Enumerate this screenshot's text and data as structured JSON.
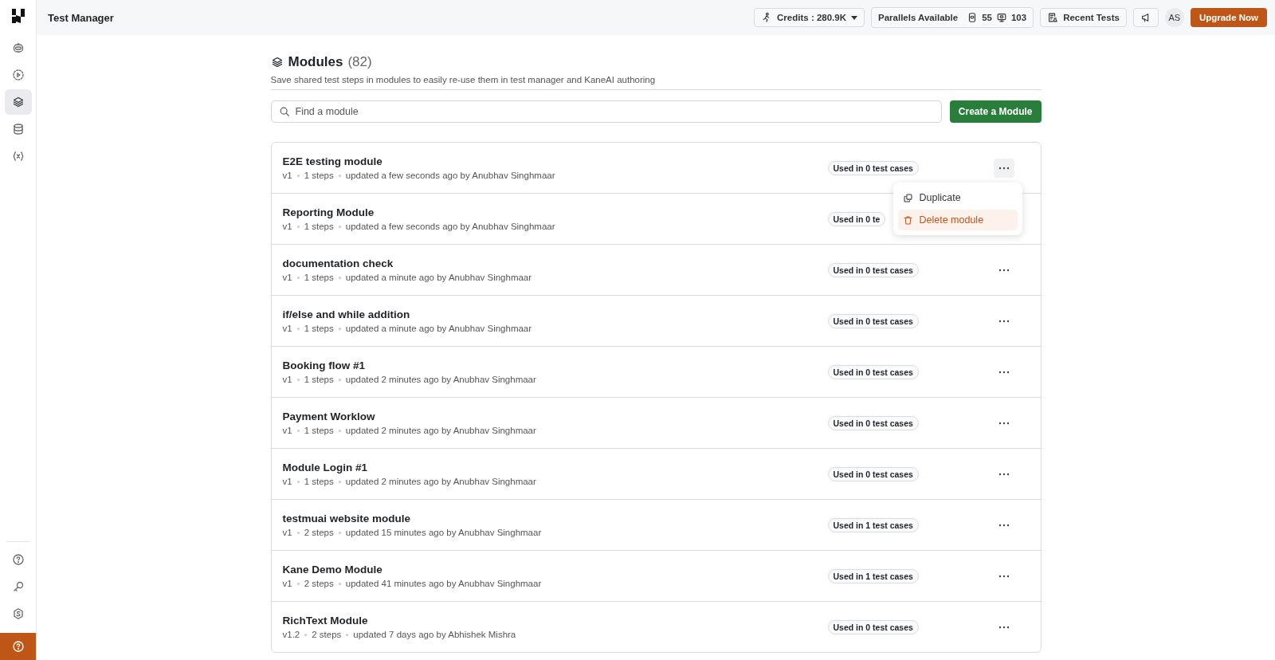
{
  "sidebar": {
    "nav": [
      {
        "selected": false
      },
      {
        "selected": false
      },
      {
        "selected": true
      },
      {
        "selected": false
      },
      {
        "selected": false
      }
    ]
  },
  "topbar": {
    "title": "Test Manager",
    "credits": "Credits : 280.9K",
    "parallels": {
      "label": "Parallels Available",
      "counts": [
        "55",
        "103"
      ]
    },
    "recent_tests": "Recent Tests",
    "avatar": "AS",
    "upgrade": "Upgrade Now"
  },
  "page": {
    "title": "Modules",
    "count": "(82)",
    "subtitle": "Save shared test steps in modules to easily re-use them in test manager and KaneAI authoring",
    "search": {
      "placeholder": "Find a module"
    },
    "create_button": "Create a Module"
  },
  "modules": [
    {
      "name": "E2E testing module",
      "version": "v1",
      "steps": "1 steps",
      "updated": "updated a few seconds ago by Anubhav Singhmaar",
      "usage": "Used in 0 test cases",
      "menu": {
        "items": [
          {
            "label": "Duplicate",
            "kind": "duplicate",
            "selected": false
          },
          {
            "label": "Delete module",
            "kind": "delete",
            "selected": true
          }
        ]
      }
    },
    {
      "name": "Reporting Module",
      "version": "v1",
      "steps": "1 steps",
      "updated": "updated a few seconds ago by Anubhav Singhmaar",
      "usage": "Used in 0 te"
    },
    {
      "name": "documentation check",
      "version": "v1",
      "steps": "1 steps",
      "updated": "updated a minute ago by Anubhav Singhmaar",
      "usage": "Used in 0 test cases"
    },
    {
      "name": "if/else and while addition",
      "version": "v1",
      "steps": "1 steps",
      "updated": "updated a minute ago by Anubhav Singhmaar",
      "usage": "Used in 0 test cases"
    },
    {
      "name": "Booking flow #1",
      "version": "v1",
      "steps": "1 steps",
      "updated": "updated 2 minutes ago by Anubhav Singhmaar",
      "usage": "Used in 0 test cases"
    },
    {
      "name": "Payment Worklow",
      "version": "v1",
      "steps": "1 steps",
      "updated": "updated 2 minutes ago by Anubhav Singhmaar",
      "usage": "Used in 0 test cases"
    },
    {
      "name": "Module Login #1",
      "version": "v1",
      "steps": "1 steps",
      "updated": "updated 2 minutes ago by Anubhav Singhmaar",
      "usage": "Used in 0 test cases"
    },
    {
      "name": "testmuai website module",
      "version": "v1",
      "steps": "2 steps",
      "updated": "updated 15 minutes ago by Anubhav Singhmaar",
      "usage": "Used in 1 test cases"
    },
    {
      "name": "Kane Demo Module",
      "version": "v1",
      "steps": "2 steps",
      "updated": "updated 41 minutes ago by Anubhav Singhmaar",
      "usage": "Used in 1 test cases"
    },
    {
      "name": "RichText Module",
      "version": "v1.2",
      "steps": "2 steps",
      "updated": "updated 7 days ago by Abhishek Mishra",
      "usage": "Used in 0 test cases"
    }
  ]
}
